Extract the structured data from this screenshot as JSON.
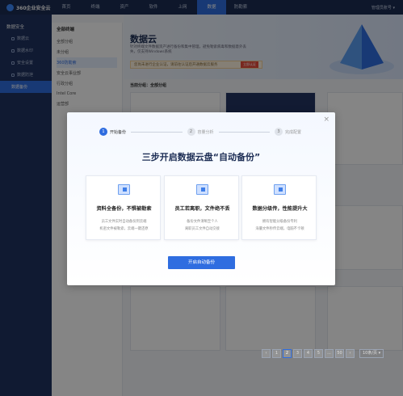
{
  "app": {
    "logo_text": "360企业安全云",
    "user_text": "管理员账号 ▾"
  },
  "nav": {
    "items": [
      {
        "label": "首页"
      },
      {
        "label": "终端"
      },
      {
        "label": "资产"
      },
      {
        "label": "软件"
      },
      {
        "label": "上网"
      },
      {
        "label": "数据"
      },
      {
        "label": "防勒索"
      }
    ],
    "active_index": 5
  },
  "sidebar": {
    "title": "数据安全",
    "items": [
      {
        "label": "数据云"
      },
      {
        "label": "数据水印"
      },
      {
        "label": "安全设置"
      },
      {
        "label": "数据防泄"
      },
      {
        "label": "数据备份"
      }
    ]
  },
  "tree": {
    "head": "全部终端",
    "rows": [
      {
        "label": "全部分组",
        "count": ""
      },
      {
        "label": "未分组",
        "count": ""
      },
      {
        "label": "360防勒索",
        "count": ""
      },
      {
        "label": "安全云事业部",
        "count": ""
      },
      {
        "label": "行政分组",
        "count": ""
      },
      {
        "label": "Intel Core",
        "count": ""
      },
      {
        "label": "运营部",
        "count": ""
      }
    ]
  },
  "hero": {
    "title": "数据云",
    "desc": "针对终端文件数据资产进行备份和集中管理，避免勒索病毒和数据意外丢失，仅支持Windows系统",
    "warn": "您尚未进行企业认证，请前往认证后开通数据云服务",
    "warn_btn": "立即认证"
  },
  "group_label": "当前分组：全部分组",
  "modal": {
    "steps": [
      {
        "num": "1",
        "label": "开始备份"
      },
      {
        "num": "2",
        "label": "容量分析"
      },
      {
        "num": "3",
        "label": "完成配置"
      }
    ],
    "title": "三步开启数据云盘“自动备份”",
    "features": [
      {
        "title": "资料全备份，不惧被勒索",
        "line1": "员工文件实时自动备份到云端",
        "line2": "机密文件被勒索，云端一键还原"
      },
      {
        "title": "员工若离职，文件绝不丢",
        "line1": "备份文件清晰至个人",
        "line2": "离职员工文件自动交接"
      },
      {
        "title": "数据分级传，性能提升大",
        "line1": "拥有智能分级备份专利",
        "line2": "海量文件秒传云端，电脑不卡顿"
      }
    ],
    "cta": "开启自动备份"
  },
  "pager": {
    "prev": "‹",
    "pages": [
      "1",
      "2",
      "3",
      "4",
      "5",
      "...",
      "50"
    ],
    "current": "2",
    "next": "›",
    "size": "10条/页 ▾"
  },
  "colors": {
    "primary": "#2f6de0",
    "nav_bg": "#1c2d54",
    "sidebar_bg": "#1f3361"
  }
}
